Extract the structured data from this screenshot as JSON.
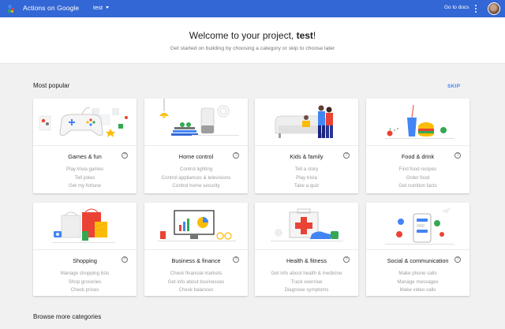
{
  "topbar": {
    "app_title": "Actions on Google",
    "project": "test",
    "docs_link": "Go to docs",
    "colors": {
      "bar": "#3367d6"
    }
  },
  "welcome": {
    "title_prefix": "Welcome to your project, ",
    "project_name": "test",
    "title_suffix": "!",
    "subtitle": "Get started on building by choosing a category or skip to choose later"
  },
  "most_popular": {
    "title": "Most popular",
    "skip": "SKIP"
  },
  "cards": [
    {
      "title": "Games & fun",
      "lines": [
        "Play trivia games",
        "Tell jokes",
        "Get my fortune"
      ],
      "icon": "gamepad-illustration"
    },
    {
      "title": "Home control",
      "lines": [
        "Control lighting",
        "Control appliances & televisions",
        "Control home security"
      ],
      "icon": "smart-home-illustration"
    },
    {
      "title": "Kids & family",
      "lines": [
        "Tell a story",
        "Play trivia",
        "Take a quiz"
      ],
      "icon": "family-illustration"
    },
    {
      "title": "Food & drink",
      "lines": [
        "Find food recipes",
        "Order food",
        "Get nutrition facts"
      ],
      "icon": "food-illustration"
    },
    {
      "title": "Shopping",
      "lines": [
        "Manage shopping lists",
        "Shop groceries",
        "Check prices"
      ],
      "icon": "shopping-bags-illustration"
    },
    {
      "title": "Business & finance",
      "lines": [
        "Check financial markets",
        "Get info about businesses",
        "Check balances"
      ],
      "icon": "business-illustration"
    },
    {
      "title": "Health & fitness",
      "lines": [
        "Get info about health & medicine",
        "Track exercise",
        "Diagnose symptoms"
      ],
      "icon": "health-illustration"
    },
    {
      "title": "Social & communication",
      "lines": [
        "Make phone calls",
        "Manage messages",
        "Make video calls"
      ],
      "icon": "social-illustration"
    }
  ],
  "help_glyph": "?",
  "browse": {
    "title": "Browse more categories"
  }
}
